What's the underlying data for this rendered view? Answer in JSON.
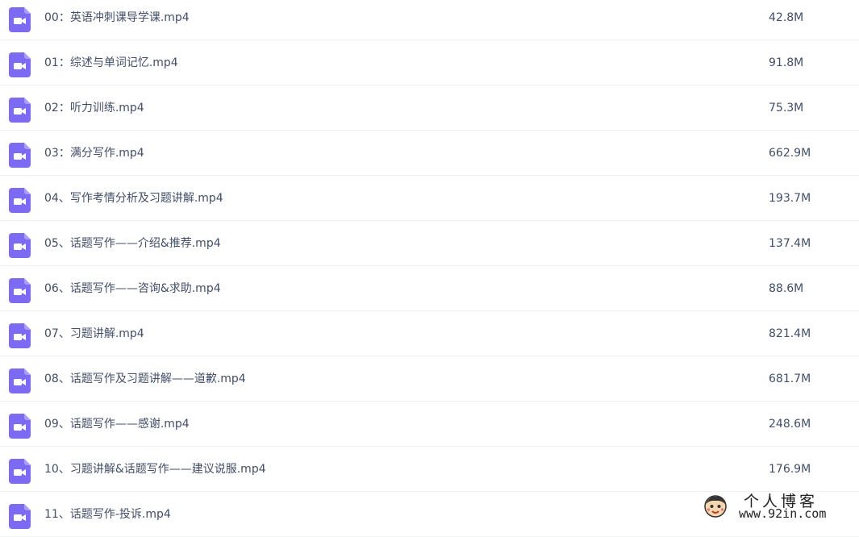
{
  "colors": {
    "icon_purple": "#7c6bf2",
    "text": "#424e67",
    "divider": "#f1f2f4"
  },
  "file_icon": "video-file-icon",
  "files": [
    {
      "name": "00：英语冲刺课导学课.mp4",
      "size": "42.8M"
    },
    {
      "name": "01：综述与单词记忆.mp4",
      "size": "91.8M"
    },
    {
      "name": "02：听力训练.mp4",
      "size": "75.3M"
    },
    {
      "name": "03：满分写作.mp4",
      "size": "662.9M"
    },
    {
      "name": "04、写作考情分析及习题讲解.mp4",
      "size": "193.7M"
    },
    {
      "name": "05、话题写作——介绍&推荐.mp4",
      "size": "137.4M"
    },
    {
      "name": "06、话题写作——咨询&求助.mp4",
      "size": "88.6M"
    },
    {
      "name": "07、习题讲解.mp4",
      "size": "821.4M"
    },
    {
      "name": "08、话题写作及习题讲解——道歉.mp4",
      "size": "681.7M"
    },
    {
      "name": "09、话题写作——感谢.mp4",
      "size": "248.6M"
    },
    {
      "name": "10、习题讲解&话题写作——建议说服.mp4",
      "size": "176.9M"
    },
    {
      "name": "11、话题写作-投诉.mp4",
      "size": ""
    }
  ],
  "watermark": {
    "title": "个人博客",
    "url": "www.92in.com"
  }
}
